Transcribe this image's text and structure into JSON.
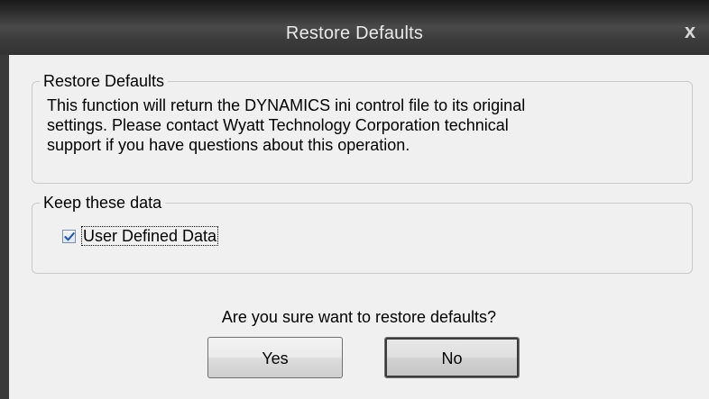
{
  "window": {
    "title": "Restore Defaults",
    "close_glyph": "x"
  },
  "restore_group": {
    "legend": "Restore Defaults",
    "description_lines": [
      "This function will return the DYNAMICS ini control file to its original",
      "settings.  Please contact Wyatt Technology Corporation technical",
      "support if you have questions about this operation."
    ]
  },
  "keep_group": {
    "legend": "Keep these data",
    "checkbox_label": "User Defined Data",
    "checked": true
  },
  "prompt": "Are you sure want to restore defaults?",
  "buttons": {
    "yes": "Yes",
    "no": "No"
  },
  "colors": {
    "titlebar": "#3a3a3a",
    "client_bg": "#f0f0f0",
    "check_mark": "#2b5aa8"
  },
  "icons": {
    "close": "close-icon",
    "check": "checkmark-icon"
  }
}
